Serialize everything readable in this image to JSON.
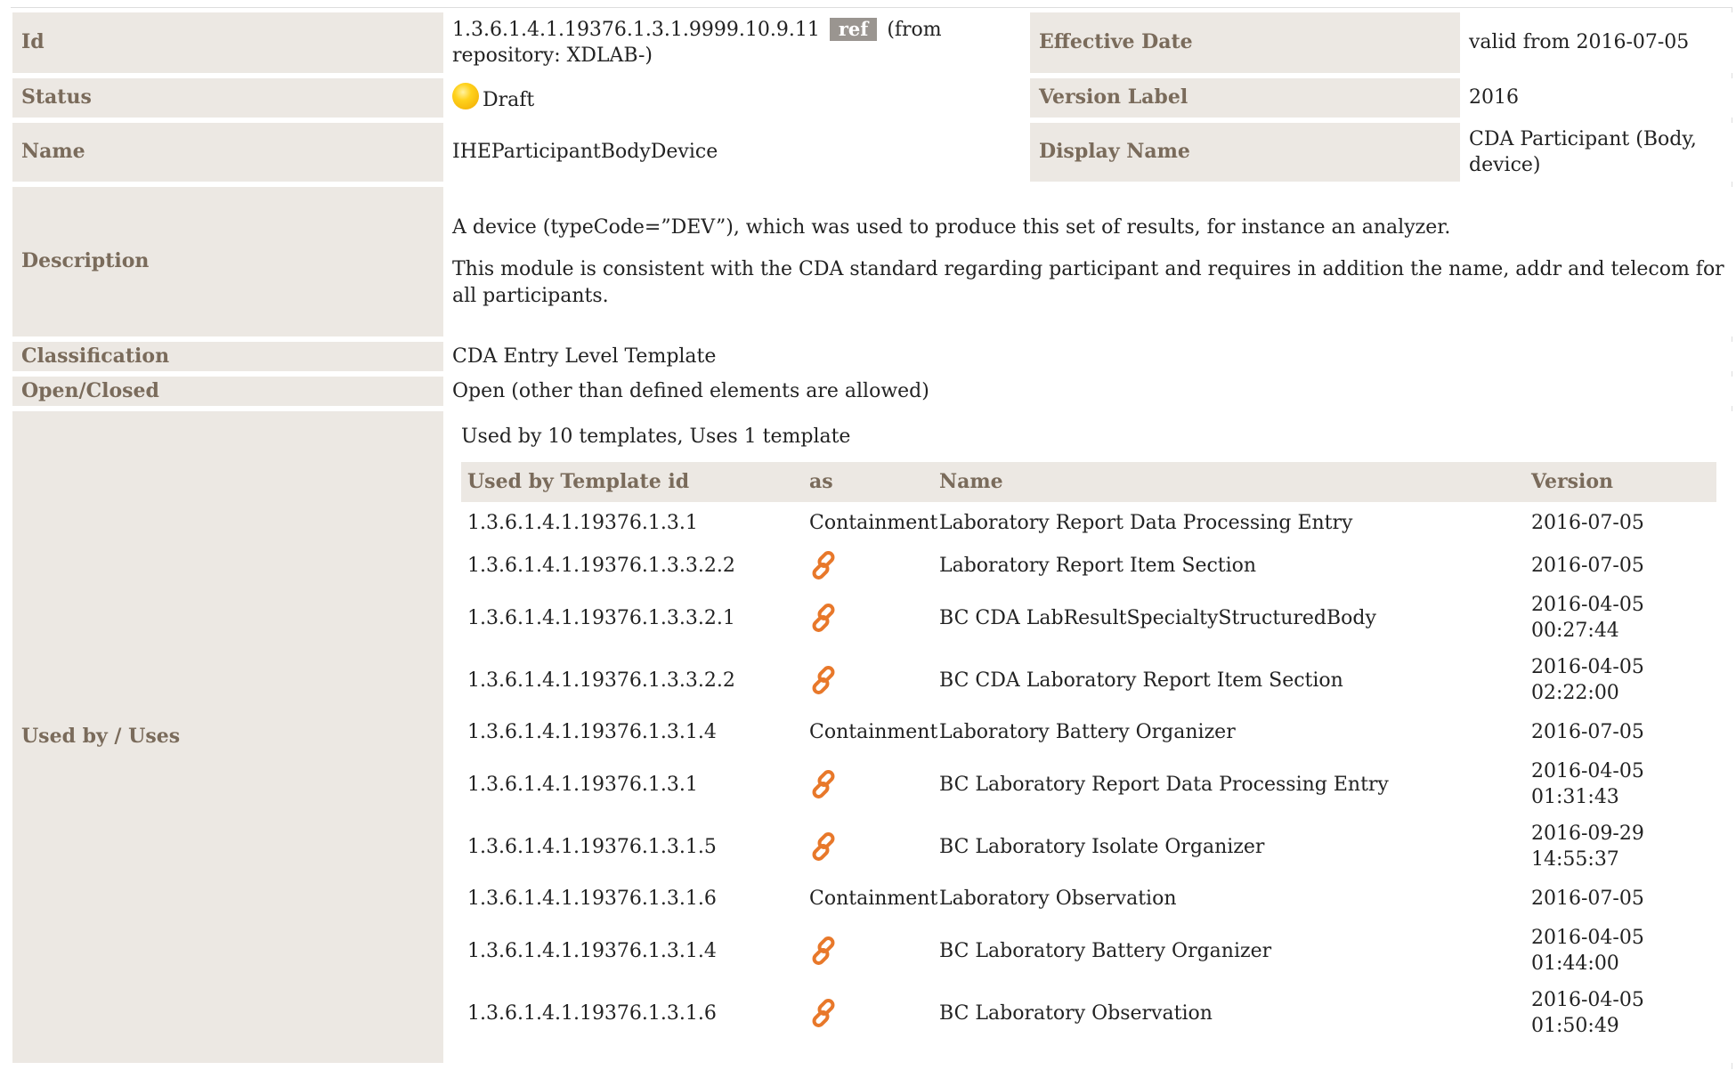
{
  "labels": {
    "id": "Id",
    "effective_date": "Effective Date",
    "status": "Status",
    "version_label": "Version Label",
    "name": "Name",
    "display_name": "Display Name",
    "description": "Description",
    "classification": "Classification",
    "open_closed": "Open/Closed",
    "used_by_uses": "Used by / Uses"
  },
  "values": {
    "id": "1.3.6.1.4.1.19376.1.3.1.9999.10.9.11",
    "ref_badge": "ref",
    "id_suffix": "(from repository: XDLAB-)",
    "effective_date": "valid from 2016-07-05",
    "status": "Draft",
    "version_label": "2016",
    "name": "IHEParticipantBodyDevice",
    "display_name": "CDA Participant (Body, device)",
    "description_1": "A device (typeCode=”DEV”), which was used to produce this set of results, for instance an analyzer.",
    "description_2": "This module is consistent with the CDA standard regarding participant and requires in addition the name, addr and telecom for all participants.",
    "classification": "CDA Entry Level Template",
    "open_closed": "Open (other than defined elements are allowed)",
    "usage_summary": "Used by 10 templates, Uses 1 template"
  },
  "usage_table": {
    "headers": [
      "Used by Template id",
      "as",
      "Name",
      "Version"
    ],
    "rows": [
      {
        "id": "1.3.6.1.4.1.19376.1.3.1",
        "as": "Containment",
        "name": "Laboratory Report Data Processing Entry",
        "version": "2016-07-05"
      },
      {
        "id": "1.3.6.1.4.1.19376.1.3.3.2.2",
        "as": "link-icon",
        "name": "Laboratory Report Item Section",
        "version": "2016-07-05"
      },
      {
        "id": "1.3.6.1.4.1.19376.1.3.3.2.1",
        "as": "link-icon",
        "name": "BC CDA LabResultSpecialtyStructuredBody",
        "version": "2016-04-05 00:27:44"
      },
      {
        "id": "1.3.6.1.4.1.19376.1.3.3.2.2",
        "as": "link-icon",
        "name": "BC CDA Laboratory Report Item Section",
        "version": "2016-04-05 02:22:00"
      },
      {
        "id": "1.3.6.1.4.1.19376.1.3.1.4",
        "as": "Containment",
        "name": "Laboratory Battery Organizer",
        "version": "2016-07-05"
      },
      {
        "id": "1.3.6.1.4.1.19376.1.3.1",
        "as": "link-icon",
        "name": "BC Laboratory Report Data Processing Entry",
        "version": "2016-04-05 01:31:43"
      },
      {
        "id": "1.3.6.1.4.1.19376.1.3.1.5",
        "as": "link-icon",
        "name": "BC Laboratory Isolate Organizer",
        "version": "2016-09-29 14:55:37"
      },
      {
        "id": "1.3.6.1.4.1.19376.1.3.1.6",
        "as": "Containment",
        "name": "Laboratory Observation",
        "version": "2016-07-05"
      },
      {
        "id": "1.3.6.1.4.1.19376.1.3.1.4",
        "as": "link-icon",
        "name": "BC Laboratory Battery Organizer",
        "version": "2016-04-05 01:44:00"
      },
      {
        "id": "1.3.6.1.4.1.19376.1.3.1.6",
        "as": "link-icon",
        "name": "BC Laboratory Observation",
        "version": "2016-04-05 01:50:49"
      }
    ]
  },
  "colors": {
    "label_bg": "#ece8e3",
    "label_text": "#7a6b5b",
    "ref_badge_bg": "#9a9590",
    "status_draft": "#ffd21c",
    "link_icon": "#e8782a"
  }
}
